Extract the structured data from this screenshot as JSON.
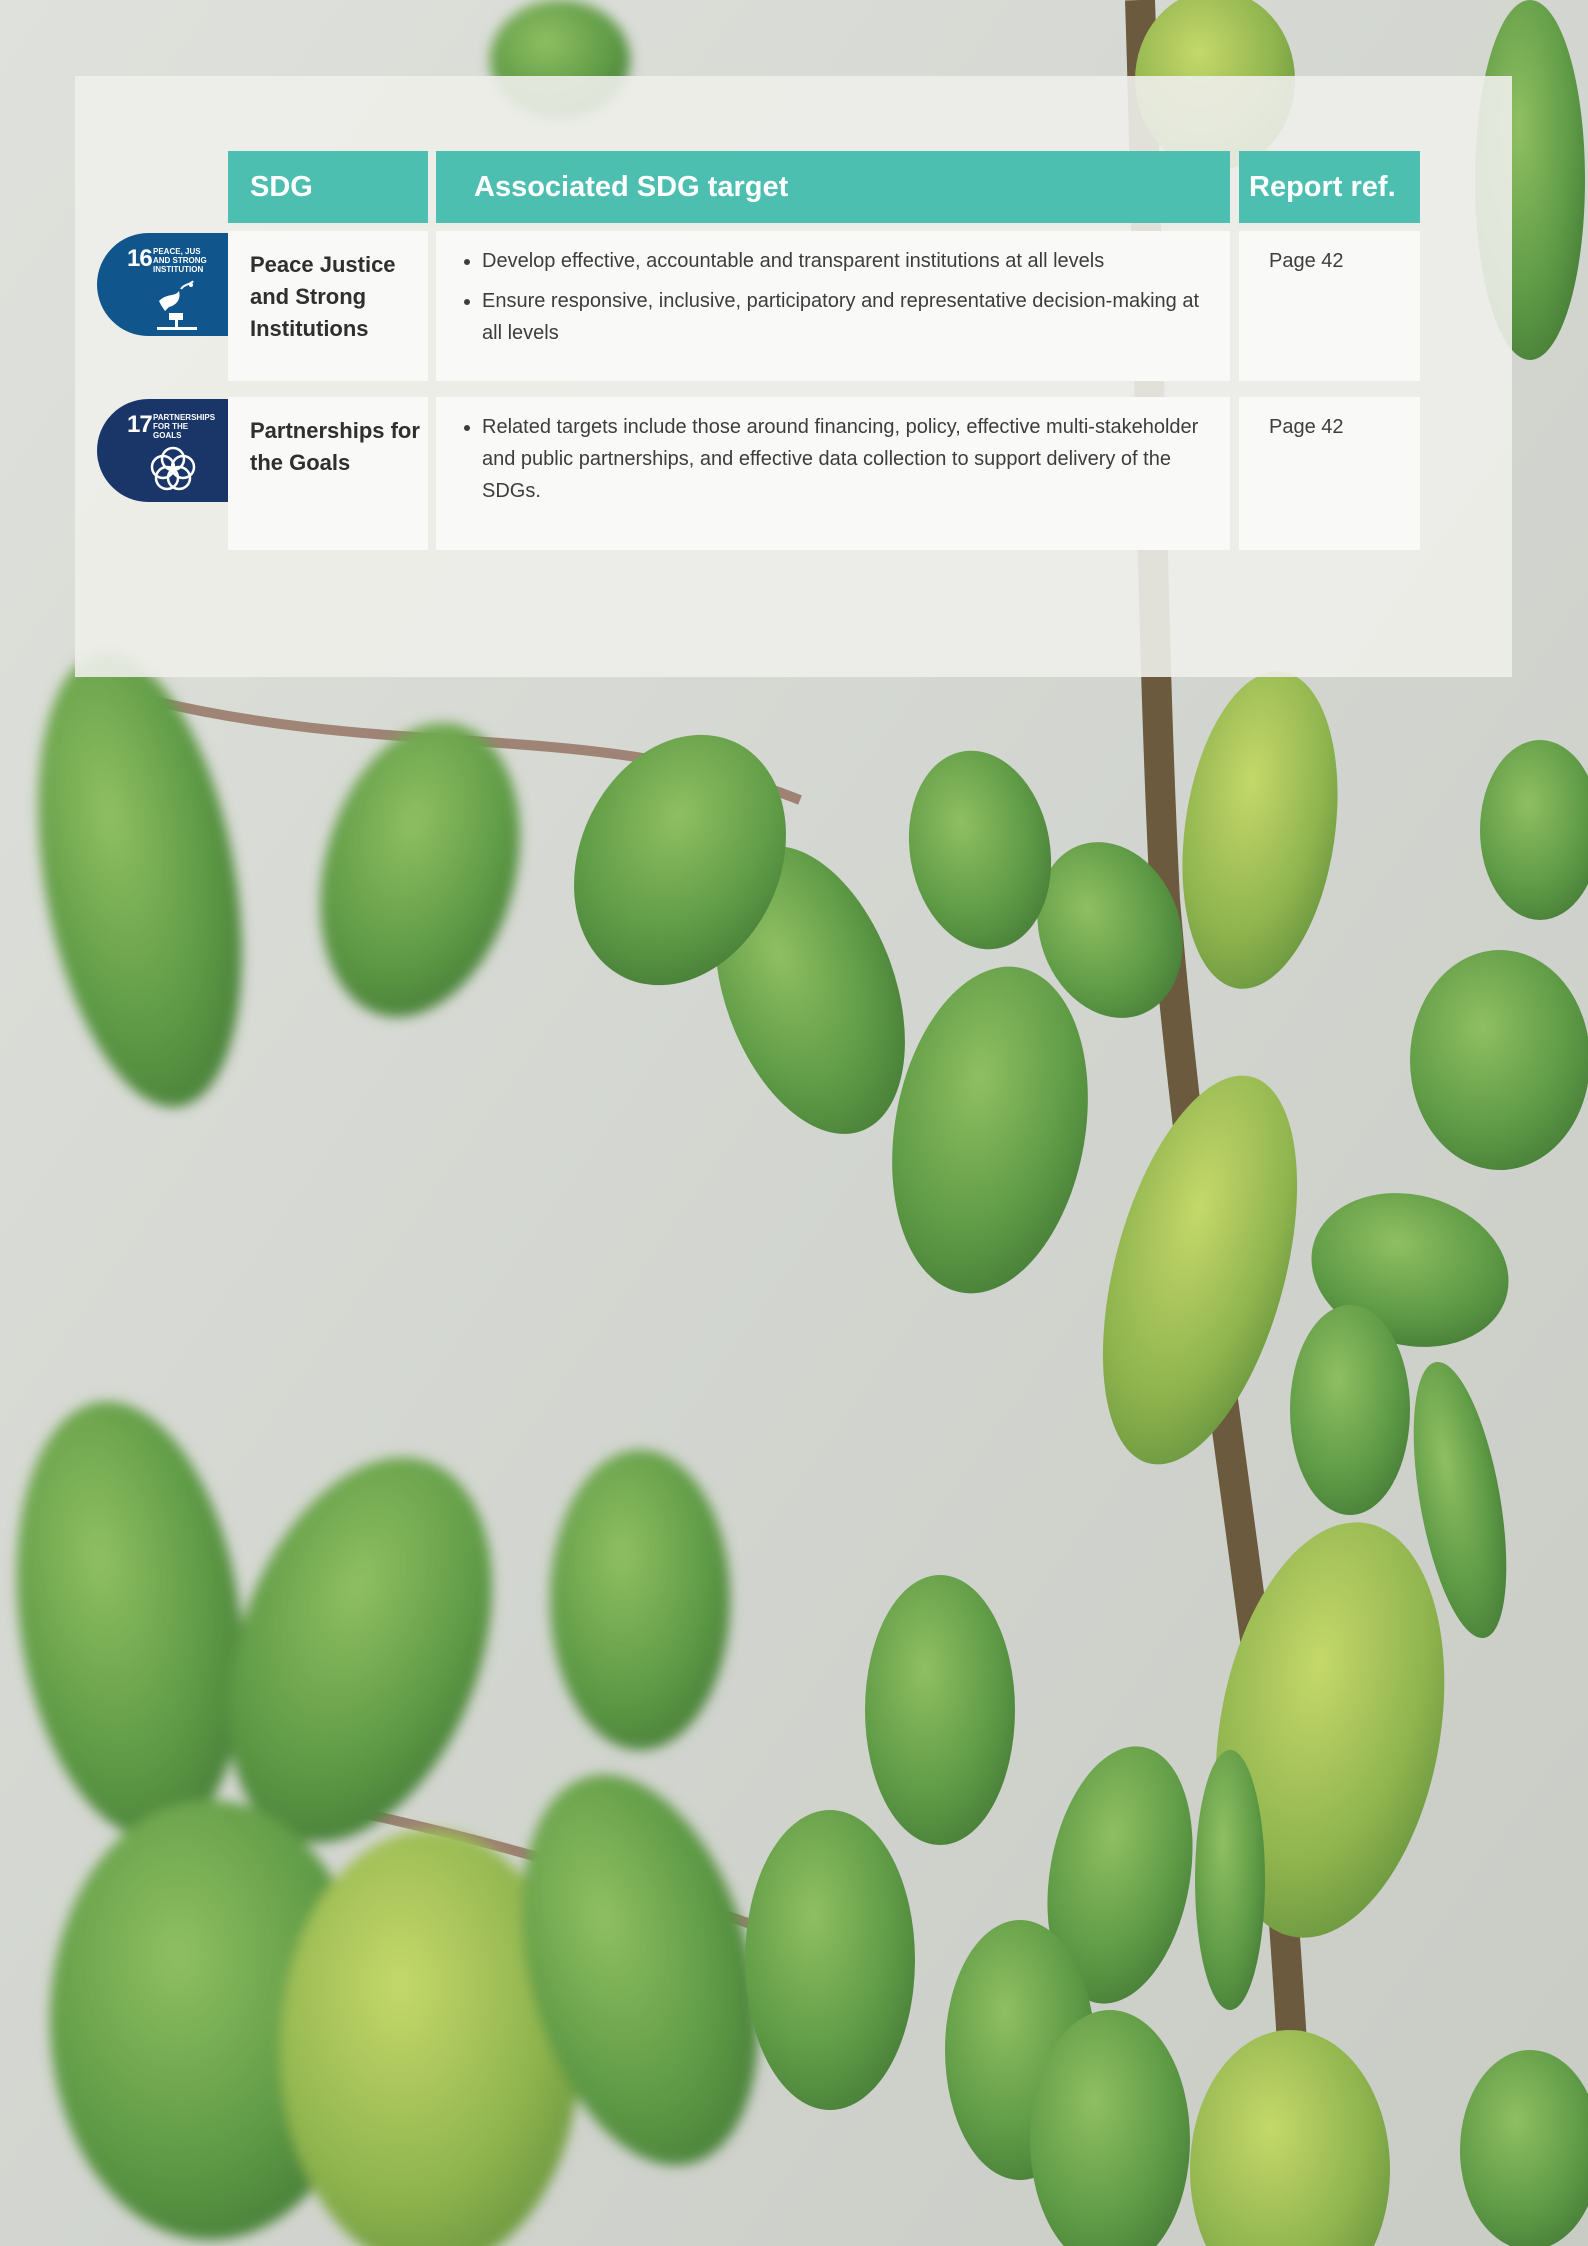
{
  "headers": {
    "sdg": "SDG",
    "target": "Associated SDG target",
    "ref": "Report ref."
  },
  "rows": [
    {
      "badge_number": "16",
      "badge_label": "PEACE, JUS AND STRONG INSTITUTION",
      "badge_color": "#10558b",
      "badge_icon": "dove-gavel-icon",
      "name": "Peace Justice and Strong Institutions",
      "targets": [
        "Develop effective, accountable and transparent institutions at all levels",
        "Ensure responsive, inclusive, participatory and representative decision-making at all levels"
      ],
      "ref": "Page 42"
    },
    {
      "badge_number": "17",
      "badge_label": "PARTNERSHIPS FOR THE GOALS",
      "badge_color": "#1a3668",
      "badge_icon": "interlocking-rings-icon",
      "name": "Partnerships for the Goals",
      "targets": [
        "Related targets include those around financing, policy, effective multi-stakeholder and public partnerships, and effective data collection to support delivery of the SDGs."
      ],
      "ref": "Page 42"
    }
  ],
  "colors": {
    "header": "#4dbfb0",
    "cell": "#f9f9f8",
    "panel": "#eeeeea"
  }
}
